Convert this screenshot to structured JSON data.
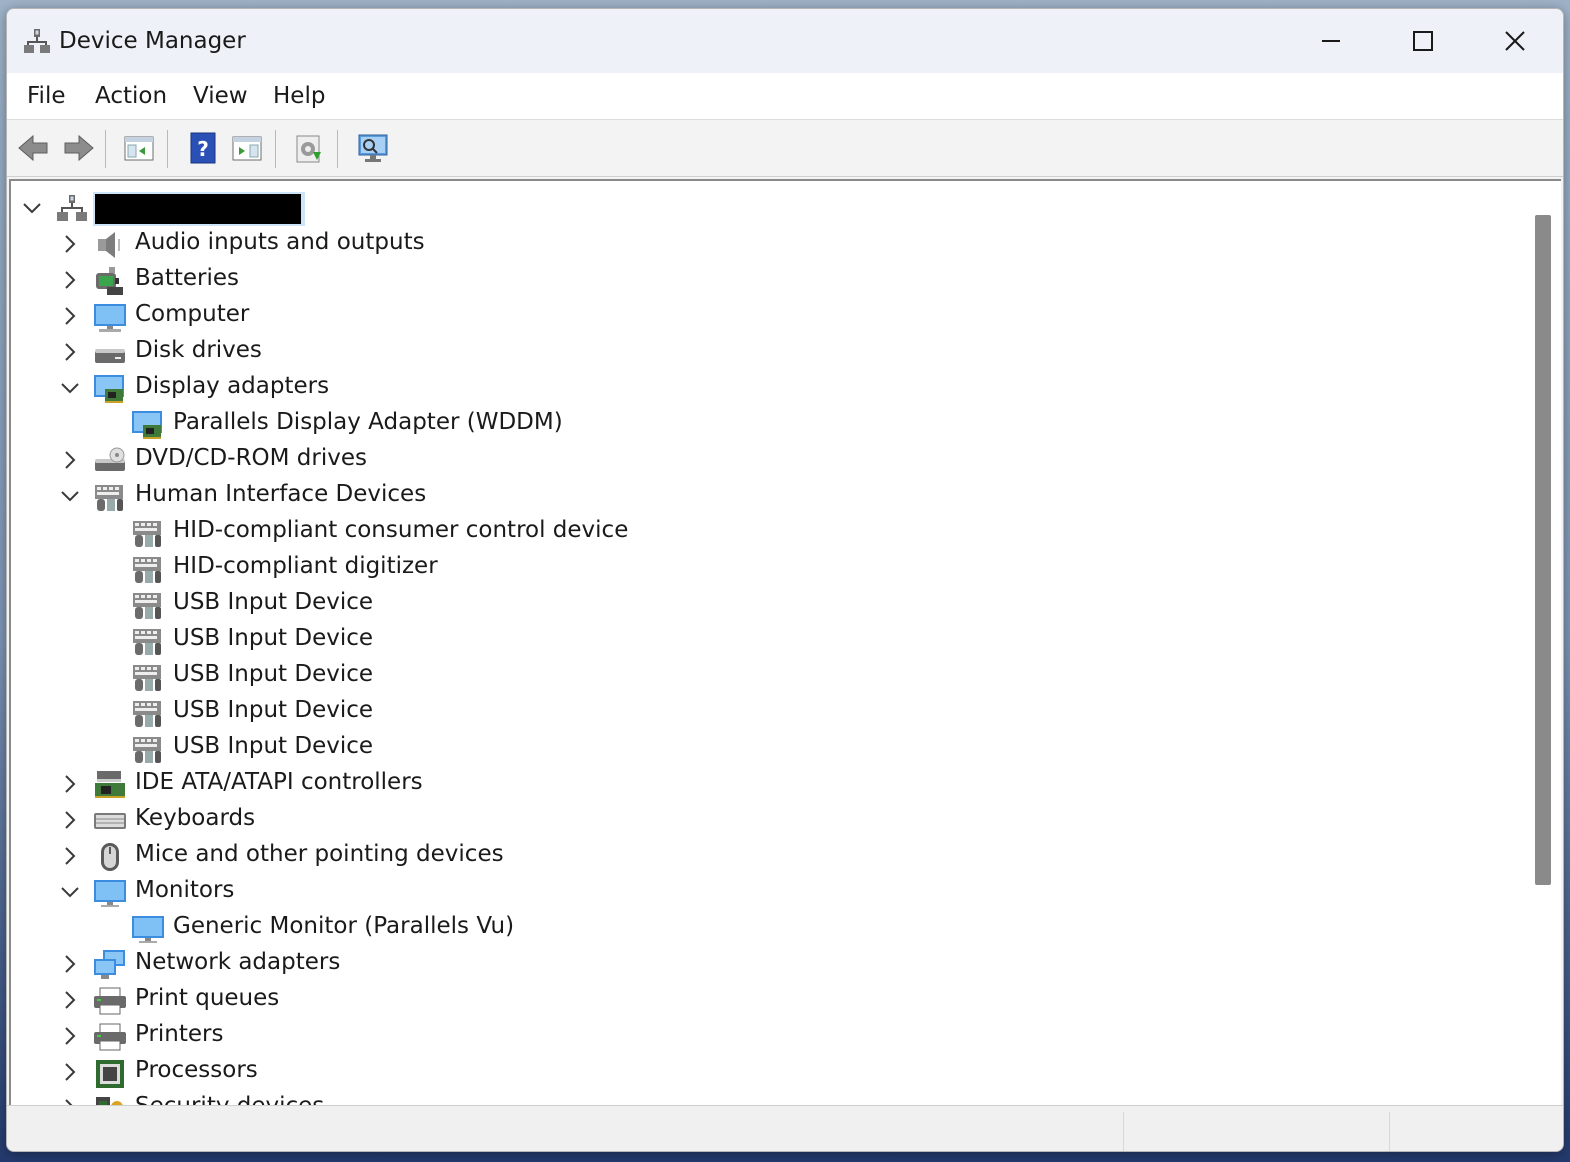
{
  "window": {
    "title": "Device Manager"
  },
  "menu": [
    "File",
    "Action",
    "View",
    "Help"
  ],
  "toolbar": {
    "buttons": [
      {
        "name": "back-button",
        "icon": "arrow-left-icon"
      },
      {
        "name": "forward-button",
        "icon": "arrow-right-icon"
      },
      {
        "name": "show-hide-console-tree-button",
        "icon": "console-tree-icon"
      },
      {
        "name": "help-button",
        "icon": "help-icon"
      },
      {
        "name": "show-hide-action-pane-button",
        "icon": "action-pane-icon"
      },
      {
        "name": "update-driver-button",
        "icon": "update-driver-icon"
      },
      {
        "name": "scan-hardware-changes-button",
        "icon": "scan-monitor-icon"
      }
    ]
  },
  "tree": {
    "root": {
      "label_redacted": true,
      "expanded": true
    },
    "rows": [
      {
        "label": "Audio inputs and outputs",
        "level": 1,
        "expander": "collapsed",
        "icon": "speaker-icon"
      },
      {
        "label": "Batteries",
        "level": 1,
        "expander": "collapsed",
        "icon": "battery-icon"
      },
      {
        "label": "Computer",
        "level": 1,
        "expander": "collapsed",
        "icon": "computer-icon"
      },
      {
        "label": "Disk drives",
        "level": 1,
        "expander": "collapsed",
        "icon": "disk-drive-icon"
      },
      {
        "label": "Display adapters",
        "level": 1,
        "expander": "expanded",
        "icon": "display-adapter-icon"
      },
      {
        "label": "Parallels Display Adapter (WDDM)",
        "level": 2,
        "expander": "none",
        "icon": "display-adapter-icon"
      },
      {
        "label": "DVD/CD-ROM drives",
        "level": 1,
        "expander": "collapsed",
        "icon": "dvd-drive-icon"
      },
      {
        "label": "Human Interface Devices",
        "level": 1,
        "expander": "expanded",
        "icon": "hid-icon"
      },
      {
        "label": "HID-compliant consumer control device",
        "level": 2,
        "expander": "none",
        "icon": "hid-icon"
      },
      {
        "label": "HID-compliant digitizer",
        "level": 2,
        "expander": "none",
        "icon": "hid-icon"
      },
      {
        "label": "USB Input Device",
        "level": 2,
        "expander": "none",
        "icon": "hid-icon"
      },
      {
        "label": "USB Input Device",
        "level": 2,
        "expander": "none",
        "icon": "hid-icon"
      },
      {
        "label": "USB Input Device",
        "level": 2,
        "expander": "none",
        "icon": "hid-icon"
      },
      {
        "label": "USB Input Device",
        "level": 2,
        "expander": "none",
        "icon": "hid-icon"
      },
      {
        "label": "USB Input Device",
        "level": 2,
        "expander": "none",
        "icon": "hid-icon"
      },
      {
        "label": "IDE ATA/ATAPI controllers",
        "level": 1,
        "expander": "collapsed",
        "icon": "ide-controller-icon"
      },
      {
        "label": "Keyboards",
        "level": 1,
        "expander": "collapsed",
        "icon": "keyboard-icon"
      },
      {
        "label": "Mice and other pointing devices",
        "level": 1,
        "expander": "collapsed",
        "icon": "mouse-icon"
      },
      {
        "label": "Monitors",
        "level": 1,
        "expander": "expanded",
        "icon": "monitor-icon"
      },
      {
        "label": "Generic Monitor (Parallels Vu)",
        "level": 2,
        "expander": "none",
        "icon": "monitor-icon"
      },
      {
        "label": "Network adapters",
        "level": 1,
        "expander": "collapsed",
        "icon": "network-adapter-icon"
      },
      {
        "label": "Print queues",
        "level": 1,
        "expander": "collapsed",
        "icon": "printer-icon"
      },
      {
        "label": "Printers",
        "level": 1,
        "expander": "collapsed",
        "icon": "printer-icon"
      },
      {
        "label": "Processors",
        "level": 1,
        "expander": "collapsed",
        "icon": "processor-icon"
      },
      {
        "label": "Security devices",
        "level": 1,
        "expander": "collapsed",
        "icon": "security-device-icon"
      }
    ]
  },
  "scrollbar": {
    "thumb_fraction": 0.72,
    "position_fraction": 0.0
  },
  "colors": {
    "selection": "#cde3f8",
    "accent": "#0067c0",
    "title_bar": "#eef2f8"
  }
}
